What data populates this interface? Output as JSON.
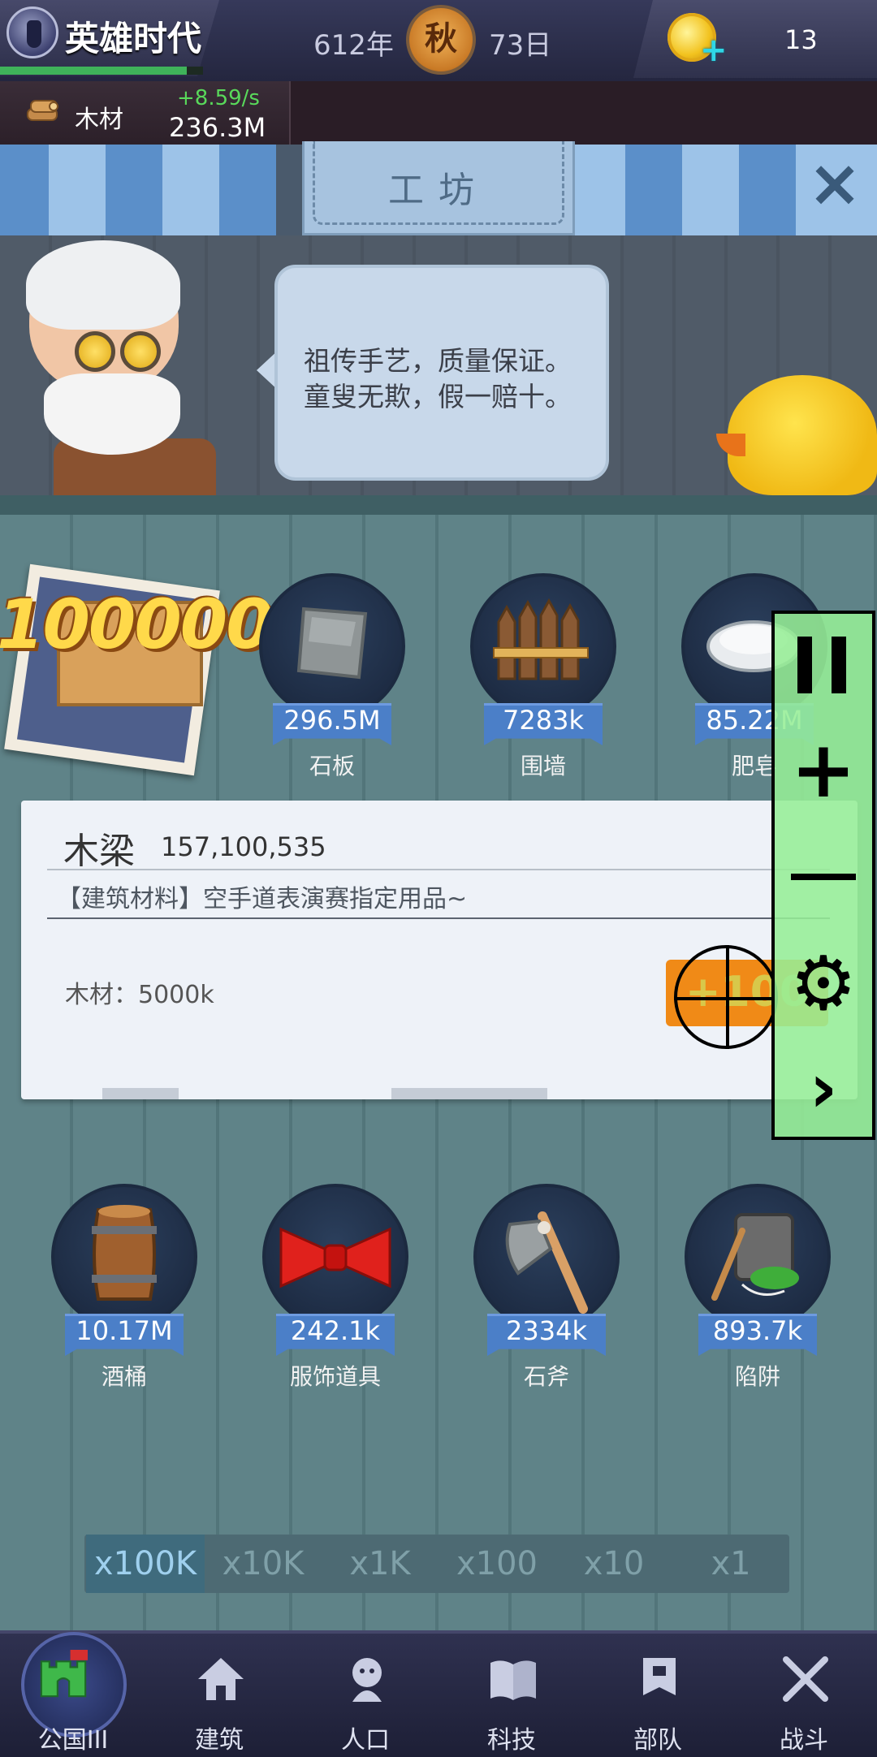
{
  "header": {
    "game_title": "英雄时代",
    "year": "612年",
    "season": "秋",
    "day": "73日",
    "coins": "13",
    "progress_fraction": 0.92
  },
  "resource": {
    "label": "木材",
    "rate": "+8.59/s",
    "amount": "236.3M"
  },
  "workshop": {
    "title": "工坊",
    "speech_line1": "祖传手艺，质量保证。",
    "speech_line2": "童叟无欺，假一赔十。"
  },
  "featured": {
    "quantity": "100000"
  },
  "items_row1": [
    {
      "count": "296.5M",
      "name": "石板",
      "icon": "stone-slab-icon"
    },
    {
      "count": "7283k",
      "name": "围墙",
      "icon": "fence-icon"
    },
    {
      "count": "85.22M",
      "name": "肥皂",
      "icon": "soap-icon"
    }
  ],
  "detail": {
    "title": "木梁",
    "count": "157,100,535",
    "description": "【建筑材料】空手道表演赛指定用品~",
    "cost": "木材：5000k",
    "craft_label": "+100"
  },
  "items_row2": [
    {
      "count": "10.17M",
      "name": "酒桶",
      "icon": "barrel-icon"
    },
    {
      "count": "242.1k",
      "name": "服饰道具",
      "icon": "bow-tie-icon"
    },
    {
      "count": "2334k",
      "name": "石斧",
      "icon": "stone-axe-icon"
    },
    {
      "count": "893.7k",
      "name": "陷阱",
      "icon": "trap-icon"
    }
  ],
  "multipliers": [
    "x100K",
    "x10K",
    "x1K",
    "x100",
    "x10",
    "x1"
  ],
  "selected_multiplier": "x100K",
  "nav": [
    {
      "label": "公国III",
      "icon": "castle-icon"
    },
    {
      "label": "建筑",
      "icon": "house-icon"
    },
    {
      "label": "人口",
      "icon": "person-icon"
    },
    {
      "label": "科技",
      "icon": "book-icon"
    },
    {
      "label": "部队",
      "icon": "banner-icon"
    },
    {
      "label": "战斗",
      "icon": "crossed-swords-icon"
    }
  ],
  "colors": {
    "accent_blue": "#4b7fc8",
    "craft_orange": "#f08a17",
    "rate_green": "#59d95b",
    "overlay_green": "#96ee96"
  }
}
